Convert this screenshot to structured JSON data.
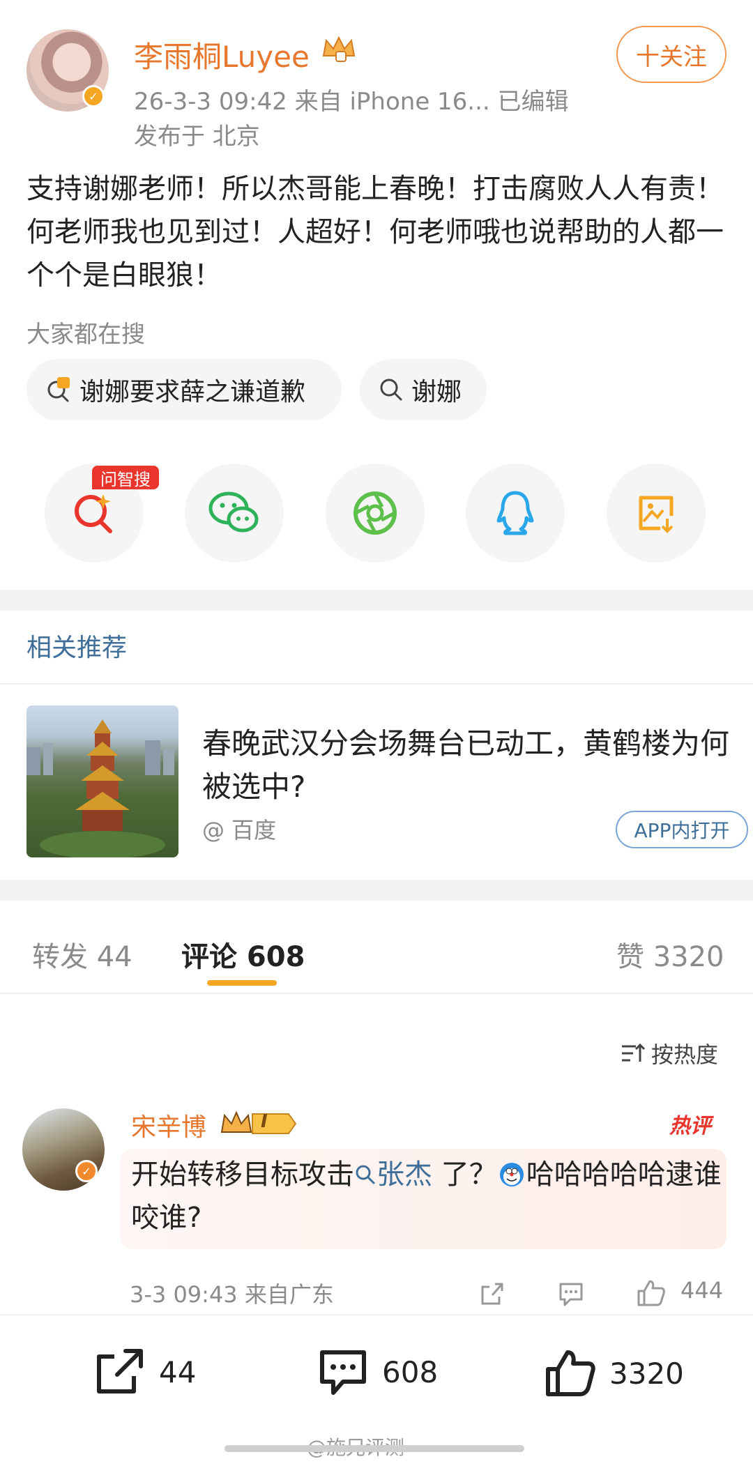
{
  "post": {
    "author": "李雨桐Luyee",
    "verified_icon": "v-badge-icon",
    "meta_line": "26-3-3 09:42  来自 iPhone 16...   已编辑",
    "location_line": "发布于 北京",
    "follow_label": "十关注",
    "body": "支持谢娜老师！所以杰哥能上春晚！打击腐败人人有责！何老师我也见到过！人超好！何老师哦也说帮助的人都一个个是白眼狼！"
  },
  "search": {
    "title": "大家都在搜",
    "chips": [
      {
        "label": "谢娜要求薛之谦道歉",
        "icon": "hot-search-icon"
      },
      {
        "label": "谢娜",
        "icon": "search-icon"
      }
    ]
  },
  "share": {
    "ai_tag": "问智搜",
    "buttons": [
      "ai-search-icon",
      "wechat-icon",
      "moments-icon",
      "qq-icon",
      "save-image-icon"
    ]
  },
  "related": {
    "title": "相关推荐",
    "item_title": "春晚武汉分会场舞台已动工，黄鹤楼为何被选中?",
    "item_source": "@ 百度",
    "open_app": "APP内打开"
  },
  "tabs": {
    "repost": "转发 44",
    "comments": "评论 608",
    "likes": "赞 3320"
  },
  "sort_label": "按热度",
  "comment": {
    "author": "宋辛博",
    "level_badge": "I",
    "hot_label": "热评",
    "text_before": "开始转移目标攻击",
    "mention": "张杰",
    "text_after": " 了？",
    "text_end": "哈哈哈哈哈逮谁咬谁?",
    "time": "3-3 09:43  来自广东",
    "like_count": "444"
  },
  "bottom_bar": {
    "repost_count": "44",
    "comment_count": "608",
    "like_count": "3320"
  },
  "watermark": "@施兄评测",
  "colors": {
    "accent": "#e8772e",
    "link": "#3f6e99",
    "hot": "#e9352c"
  }
}
